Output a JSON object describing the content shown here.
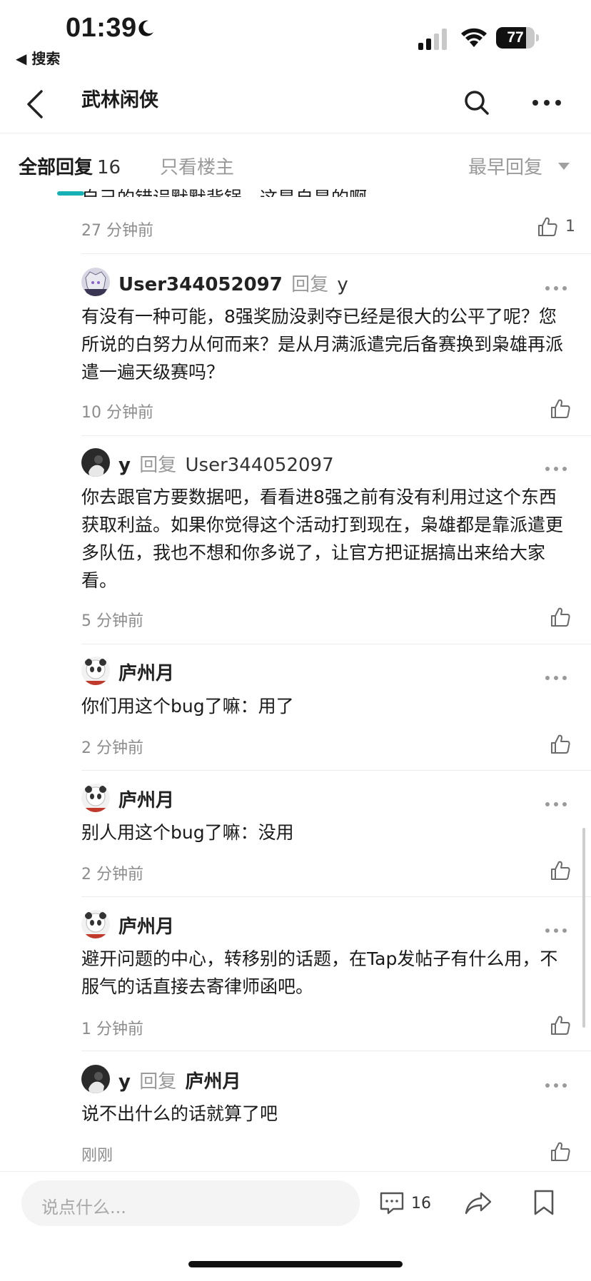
{
  "status_bar": {
    "time": "01:39",
    "back_label": "◀ 搜索",
    "battery": "77",
    "battery_level": 0.77
  },
  "nav": {
    "title": "武林闲侠"
  },
  "tabs": {
    "all_label": "全部回复",
    "all_count": "16",
    "op_only_label": "只看楼主",
    "sort_label": "最早回复"
  },
  "top_comment": {
    "cut_text": "自己的错误默默背锅，这是自是的啊。",
    "time": "27 分钟前",
    "likes": "1"
  },
  "replies": [
    {
      "user": "User344052097",
      "verb": "回复",
      "target": "y",
      "text": "有没有一种可能，8强奖励没剥夺已经是很大的公平了呢？您所说的白努力从何而来？是从月满派遣完后备赛换到枭雄再派遣一遍天级赛吗？",
      "time": "10 分钟前",
      "avatar": "anime-avatar"
    },
    {
      "user": "y",
      "verb": "回复",
      "target": "User344052097",
      "text": "你去跟官方要数据吧，看看进8强之前有没有利用过这个东西获取利益。如果你觉得这个活动打到现在，枭雄都是靠派遣更多队伍，我也不想和你多说了，让官方把证据搞出来给大家看。",
      "time": "5 分钟前",
      "avatar": "dark-avatar"
    },
    {
      "user": "庐州月",
      "verb": "",
      "target": "",
      "text": "你们用这个bug了嘛：用了",
      "time": "2 分钟前",
      "avatar": "panda-avatar"
    },
    {
      "user": "庐州月",
      "verb": "",
      "target": "",
      "text": "别人用这个bug了嘛：没用",
      "time": "2 分钟前",
      "avatar": "panda-avatar"
    },
    {
      "user": "庐州月",
      "verb": "",
      "target": "",
      "text": "避开问题的中心，转移别的话题，在Tap发帖子有什么用，不服气的话直接去寄律师函吧。",
      "time": "1 分钟前",
      "avatar": "panda-avatar"
    },
    {
      "user": "y",
      "verb": "回复",
      "target": "庐州月",
      "text": "说不出什么的话就算了吧",
      "time": "刚刚",
      "avatar": "dark-avatar"
    }
  ],
  "bottom_bar": {
    "placeholder": "说点什么...",
    "comment_count": "16"
  },
  "colors": {
    "accent": "#16b1b4",
    "muted": "#8c8c8c",
    "divider": "#ececec"
  }
}
